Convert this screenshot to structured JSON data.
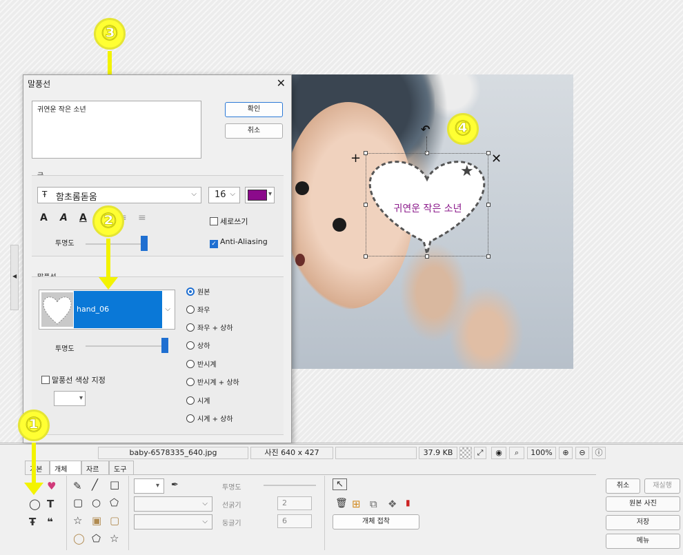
{
  "dialog": {
    "title": "말풍선",
    "text_value": "귀연운 작은 소년",
    "ok_label": "확인",
    "cancel_label": "취소",
    "font_group_label": "글",
    "font_name": "함초롬돋움",
    "font_size": "16",
    "font_color": "#8b0a8b",
    "format_buttons": [
      "A",
      "A",
      "A",
      "≡",
      "≡",
      "≡"
    ],
    "vertical_label": "세로쓰기",
    "vertical_checked": false,
    "antialias_label": "Anti-Aliasing",
    "antialias_checked": true,
    "opacity_label": "투명도",
    "balloon_group_label": "말풍선",
    "balloon_shape": "hand_06",
    "balloon_opacity_label": "투명도",
    "balloon_color_label": "말풍선 색상 지정",
    "balloon_color_checked": false,
    "orientation_options": [
      "원본",
      "좌우",
      "좌우 + 상하",
      "상하",
      "반시계",
      "반시계 + 상하",
      "시계",
      "시계 + 상하"
    ],
    "orientation_selected": "원본"
  },
  "canvas": {
    "balloon_text": "귀연운 작은 소년",
    "balloon_text_color": "#8b1a8b"
  },
  "annotations": [
    "①",
    "②",
    "③",
    "④"
  ],
  "status_bar": {
    "filename": "baby-6578335_640.jpg",
    "image_size": "사진 640 x 427",
    "file_size": "37.9 KB",
    "zoom": "100%"
  },
  "tabs": [
    "기본",
    "개체",
    "자르기",
    "도구"
  ],
  "toolbar": {
    "opacity_label": "투명도",
    "line_width_label": "선굵기",
    "line_width_value": "2",
    "round_label": "둥글기",
    "round_value": "6",
    "attach_button": "개체 접착"
  },
  "right_panel": {
    "cancel": "취소",
    "redo": "재실행",
    "original": "원본 사진",
    "save": "저장",
    "menu": "메뉴"
  }
}
